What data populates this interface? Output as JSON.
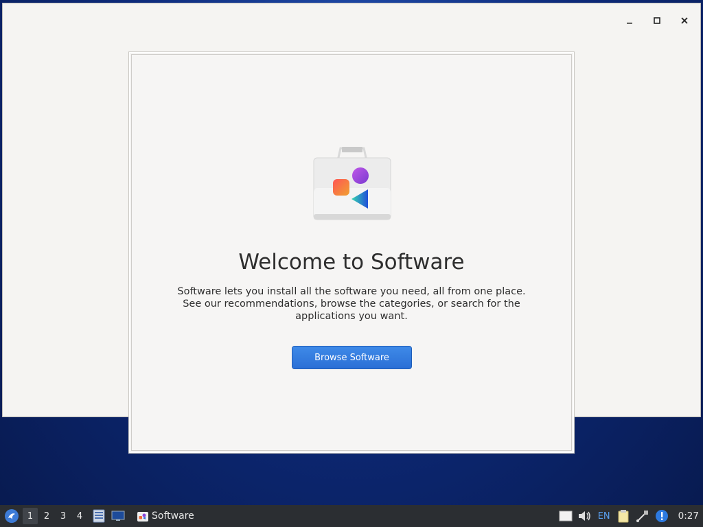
{
  "window": {
    "controls": [
      "minimize-icon",
      "maximize-icon",
      "close-icon"
    ]
  },
  "dialog": {
    "title": "Welcome to Software",
    "description": "Software lets you install all the software you need, all from one place.\nSee our recommendations, browse the categories, or search for the\napplications you want.",
    "button_label": "Browse Software",
    "accent_color": "#2a6fd6"
  },
  "taskbar": {
    "workspaces": [
      "1",
      "2",
      "3",
      "4"
    ],
    "active_workspace": "1",
    "task_label": "Software",
    "language": "EN",
    "clock": "0:27",
    "icons": [
      "start-menu-icon",
      "file-manager-icon",
      "desktop-icon",
      "software-app-icon",
      "notification-panel-icon",
      "volume-icon",
      "clipboard-icon",
      "network-icon",
      "update-alert-icon"
    ]
  }
}
